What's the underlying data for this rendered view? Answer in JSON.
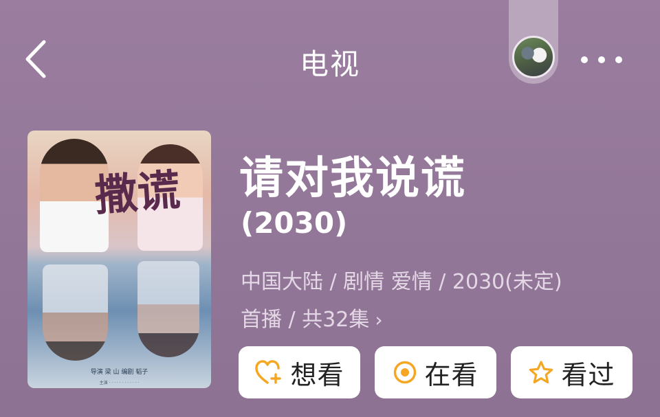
{
  "header": {
    "title": "电视",
    "back_icon": "chevron-left-icon",
    "more_icon": "more-horizontal-icon"
  },
  "poster": {
    "calligraphy": "撒谎",
    "credits_line": "导演  梁 山    编剧  韬子",
    "cast_line": "主演 · · · · · · · · · · · ·"
  },
  "show": {
    "title": "请对我说谎",
    "year": "(2030)",
    "meta_line1": "中国大陆 / 剧情 爱情 / 2030(未定)",
    "meta_line2": "首播 / 共32集",
    "meta_chevron": "›"
  },
  "actions": {
    "want": {
      "label": "想看",
      "icon": "heart-plus-icon"
    },
    "watching": {
      "label": "在看",
      "icon": "target-circle-icon"
    },
    "watched": {
      "label": "看过",
      "icon": "star-outline-icon"
    }
  },
  "colors": {
    "background": "#9a7d9f",
    "accent": "#f5a623",
    "button_bg": "#ffffff",
    "text_primary": "#ffffff",
    "text_secondary": "#e4d8e6"
  }
}
